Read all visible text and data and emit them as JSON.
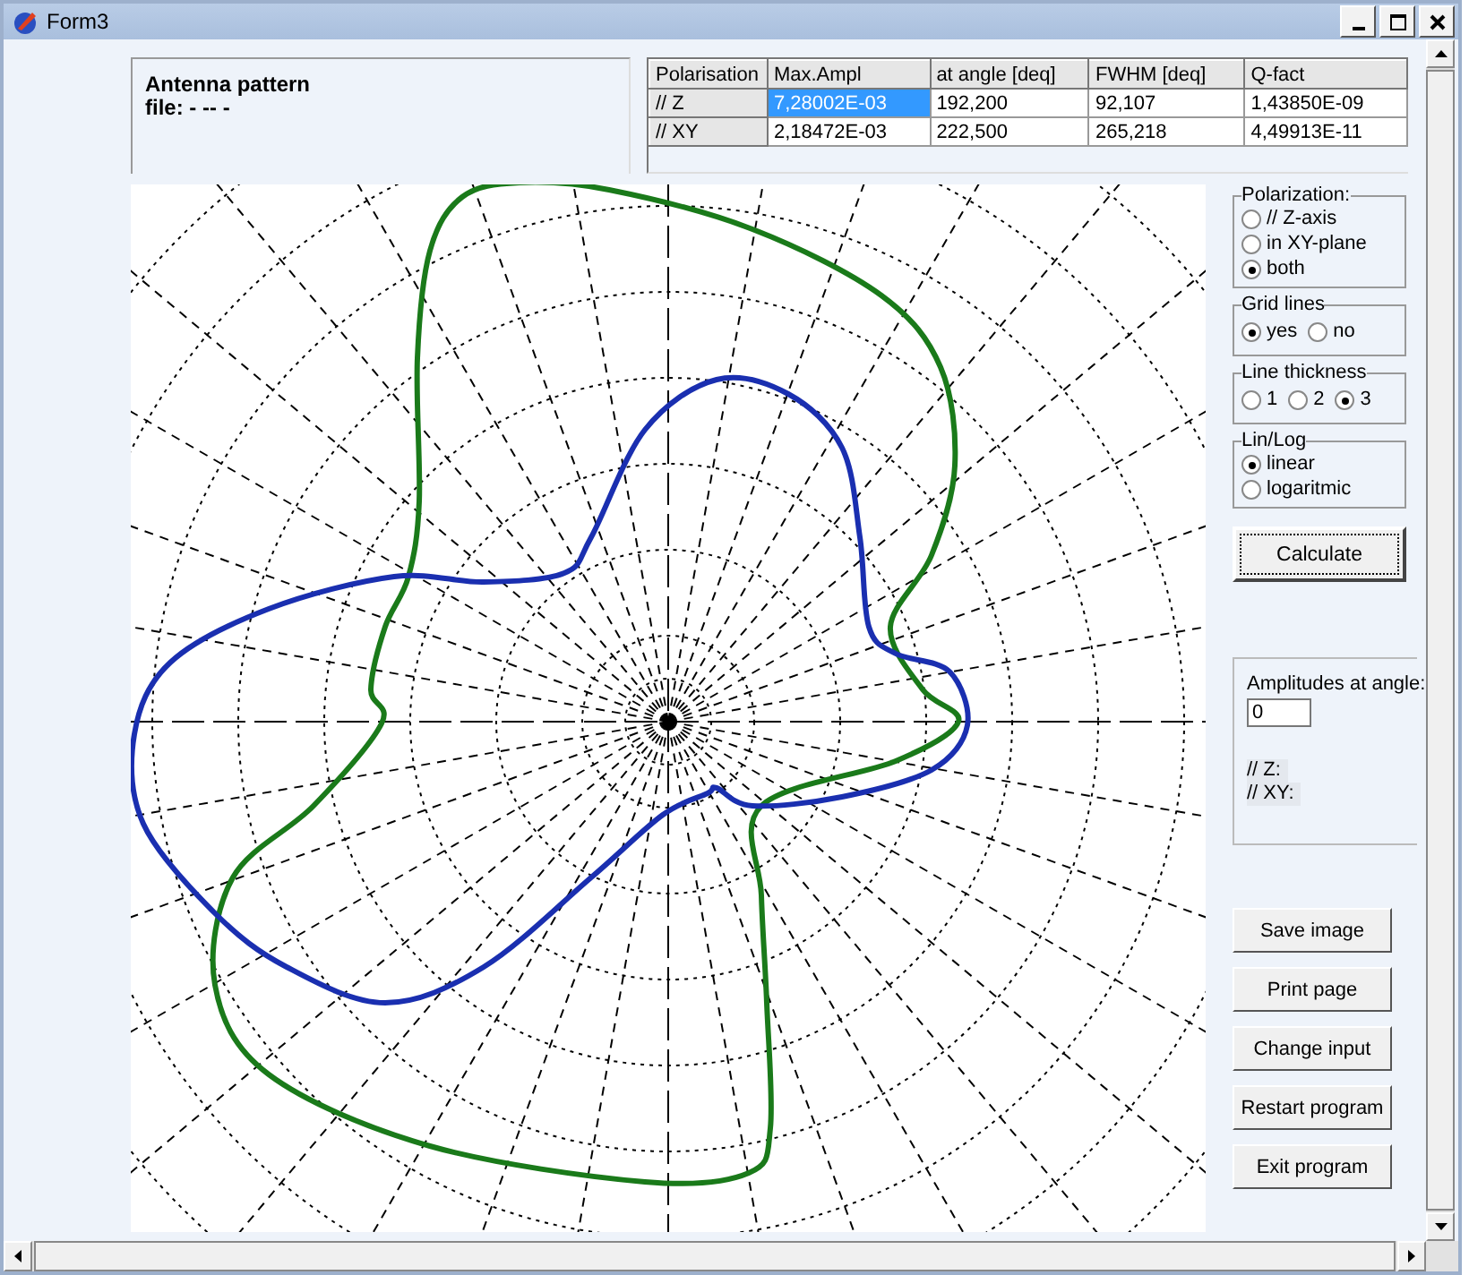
{
  "window": {
    "title": "Form3"
  },
  "info": {
    "title": "Antenna pattern",
    "file": "file: - -- -"
  },
  "table": {
    "columns": [
      "Polarisation",
      "Max.Ampl",
      "at angle [deq]",
      "FWHM [deq]",
      "Q-fact"
    ],
    "rows": [
      {
        "cells": [
          {
            "text": "// Z",
            "selected": false
          },
          {
            "text": "7,28002E-03",
            "selected": true
          },
          {
            "text": "192,200",
            "selected": false
          },
          {
            "text": "92,107",
            "selected": false
          },
          {
            "text": "1,43850E-09",
            "selected": false
          }
        ]
      },
      {
        "cells": [
          {
            "text": "// XY",
            "selected": false
          },
          {
            "text": "2,18472E-03",
            "selected": false
          },
          {
            "text": "222,500",
            "selected": false
          },
          {
            "text": "265,218",
            "selected": false
          },
          {
            "text": "4,49913E-11",
            "selected": false
          }
        ]
      }
    ]
  },
  "option_groups": [
    {
      "title": "Polarization:",
      "kind": "stacked",
      "options": [
        {
          "label": "// Z-axis",
          "selected": false
        },
        {
          "label": "in XY-plane",
          "selected": false
        },
        {
          "label": "both",
          "selected": true
        }
      ]
    },
    {
      "title": "Grid lines",
      "kind": "inline",
      "options": [
        {
          "label": "yes",
          "selected": true
        },
        {
          "label": "no",
          "selected": false
        }
      ]
    },
    {
      "title": "Line thickness",
      "kind": "inline",
      "options": [
        {
          "label": "1",
          "selected": false
        },
        {
          "label": "2",
          "selected": false
        },
        {
          "label": "3",
          "selected": true
        }
      ]
    },
    {
      "title": "Lin/Log",
      "kind": "stacked",
      "options": [
        {
          "label": "linear",
          "selected": true
        },
        {
          "label": "logaritmic",
          "selected": false
        }
      ]
    }
  ],
  "calculate_button": "Calculate",
  "amplitudes": {
    "label": "Amplitudes at angle:",
    "value": "0",
    "readings": [
      "// Z:",
      "// XY:"
    ]
  },
  "buttons": [
    "Save image",
    "Print page",
    "Change input",
    "Restart program",
    "Exit program"
  ]
}
